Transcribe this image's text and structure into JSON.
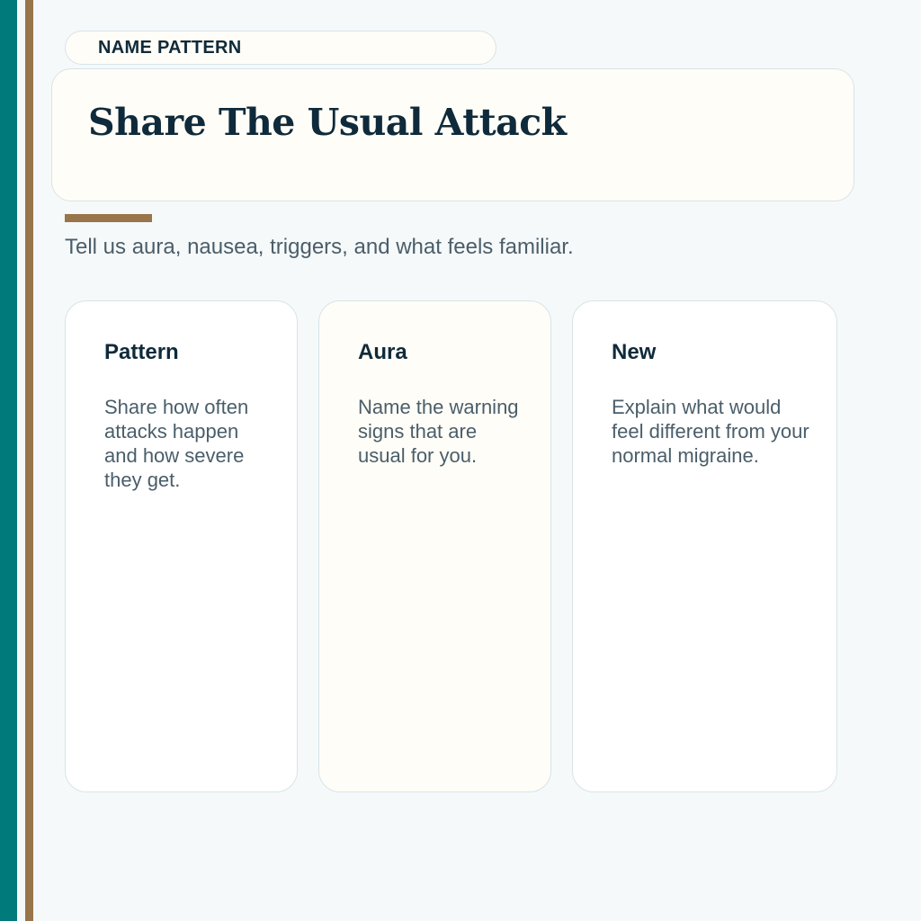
{
  "colors": {
    "teal_rail": "#007a7a",
    "brown_accent": "#98754a",
    "heading": "#0f2a3a",
    "body_text": "#4a5e6a",
    "card_border": "#d7e4e8",
    "cream_fill": "#fffdf7",
    "page_bg": "#f6f9fa"
  },
  "header": {
    "eyebrow": "NAME PATTERN",
    "title": "Share The Usual Attack",
    "subtitle": "Tell us aura, nausea, triggers, and what feels familiar."
  },
  "cards": [
    {
      "title": "Pattern",
      "body": "Share how often attacks happen and how severe they get."
    },
    {
      "title": "Aura",
      "body": "Name the warning signs that are usual for you."
    },
    {
      "title": "New",
      "body": "Explain what would feel different from your normal migraine."
    }
  ]
}
